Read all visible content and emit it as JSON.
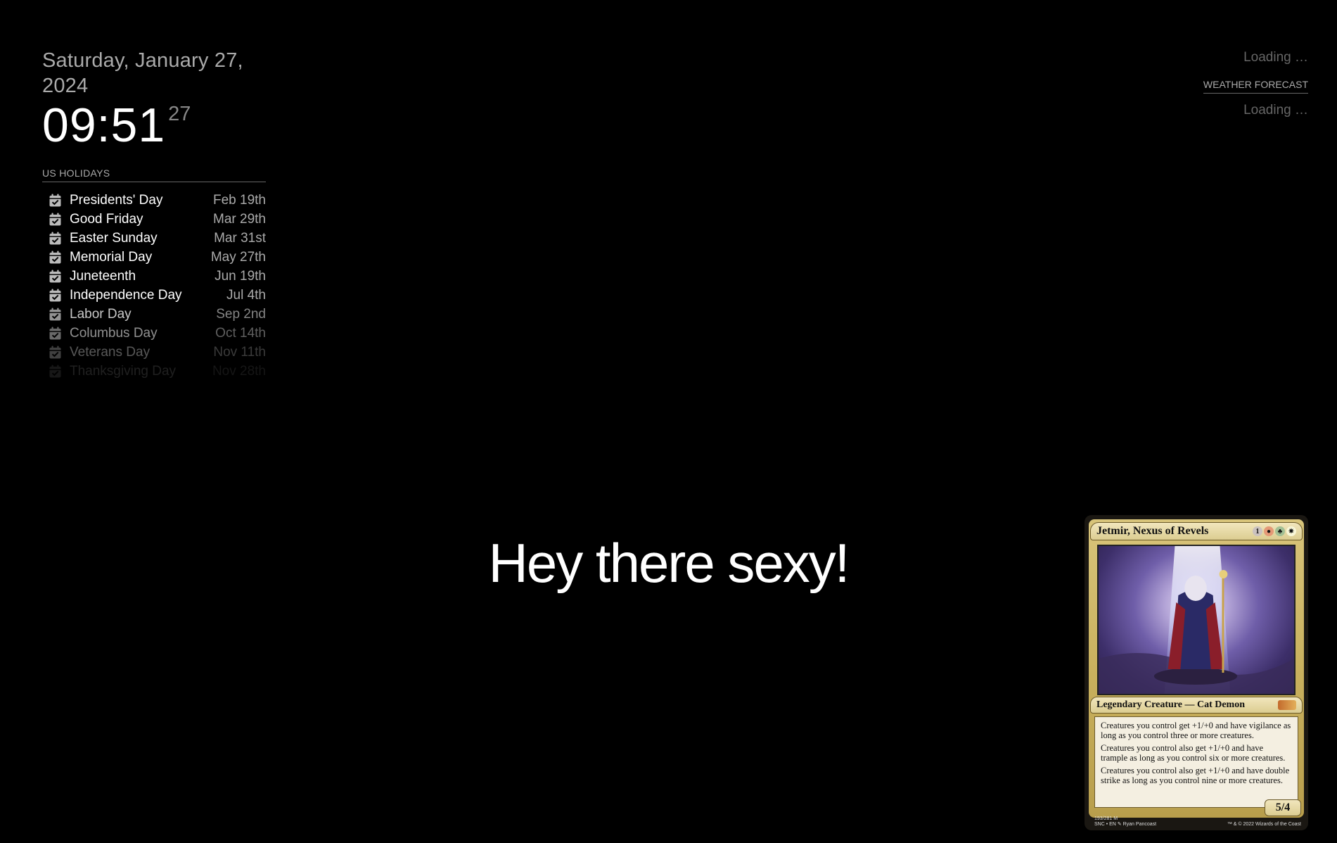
{
  "clock": {
    "date": "Saturday, January 27, 2024",
    "time": "09:51",
    "seconds": "27"
  },
  "calendar": {
    "header": "US HOLIDAYS",
    "icon": "calendar-check-icon",
    "events": [
      {
        "title": "Presidents' Day",
        "date": "Feb 19th"
      },
      {
        "title": "Good Friday",
        "date": "Mar 29th"
      },
      {
        "title": "Easter Sunday",
        "date": "Mar 31st"
      },
      {
        "title": "Memorial Day",
        "date": "May 27th"
      },
      {
        "title": "Juneteenth",
        "date": "Jun 19th"
      },
      {
        "title": "Independence Day",
        "date": "Jul 4th"
      },
      {
        "title": "Labor Day",
        "date": "Sep 2nd"
      },
      {
        "title": "Columbus Day",
        "date": "Oct 14th"
      },
      {
        "title": "Veterans Day",
        "date": "Nov 11th"
      },
      {
        "title": "Thanksgiving Day",
        "date": "Nov 28th"
      }
    ]
  },
  "weather": {
    "current_loading": "Loading …",
    "forecast_header": "WEATHER FORECAST",
    "forecast_loading": "Loading …"
  },
  "compliments": {
    "text": "Hey there sexy!"
  },
  "mtg_card": {
    "name": "Jetmir, Nexus of Revels",
    "mana_cost": [
      "1",
      "R",
      "G",
      "W"
    ],
    "type_line": "Legendary Creature — Cat Demon",
    "rules_text": [
      "Creatures you control get +1/+0 and have vigilance as long as you control three or more creatures.",
      "Creatures you control also get +1/+0 and have trample as long as you control six or more creatures.",
      "Creatures you control also get +1/+0 and have double strike as long as you control nine or more creatures."
    ],
    "power_toughness": "5/4",
    "collector": "193/281 M",
    "set_lang": "SNC • EN",
    "artist": "Ryan Pancoast",
    "copyright": "™ & © 2022 Wizards of the Coast"
  }
}
